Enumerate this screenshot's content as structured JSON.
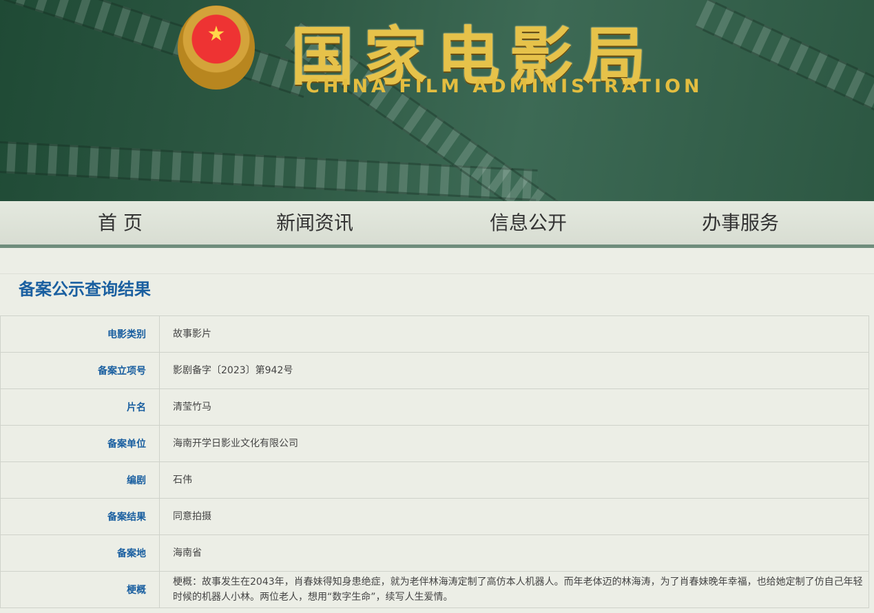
{
  "header": {
    "logo_cn": "国家电影局",
    "logo_en": "CHINA FILM ADMINISTRATION",
    "emblem": "national-emblem"
  },
  "nav": [
    {
      "label": "首 页"
    },
    {
      "label": "新闻资讯"
    },
    {
      "label": "信息公开"
    },
    {
      "label": "办事服务"
    }
  ],
  "page_title": "备案公示查询结果",
  "rows": [
    {
      "label": "电影类别",
      "value": "故事影片"
    },
    {
      "label": "备案立项号",
      "value": "影剧备字〔2023〕第942号"
    },
    {
      "label": "片名",
      "value": "清莹竹马"
    },
    {
      "label": "备案单位",
      "value": "海南开学日影业文化有限公司"
    },
    {
      "label": "编剧",
      "value": "石伟"
    },
    {
      "label": "备案结果",
      "value": "同意拍摄"
    },
    {
      "label": "备案地",
      "value": "海南省"
    },
    {
      "label": "梗概",
      "value": "梗概：故事发生在2043年，肖春妹得知身患绝症，就为老伴林海涛定制了高仿本人机器人。而年老体迈的林海涛，为了肖春妹晚年幸福，也给她定制了仿自己年轻时候的机器人小林。两位老人，想用“数字生命”，续写人生爱情。"
    }
  ]
}
